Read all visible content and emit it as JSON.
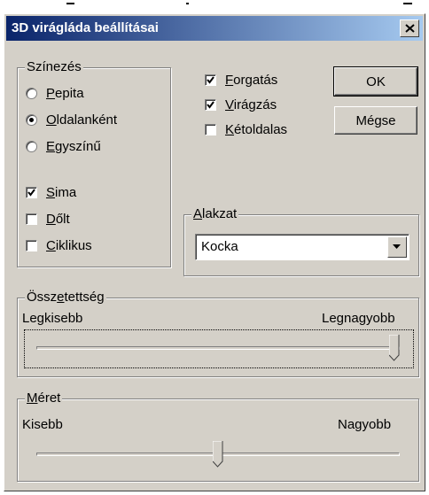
{
  "window": {
    "title": "3D virágláda beállításai",
    "close_glyph": "close-icon"
  },
  "coloring": {
    "legend": "Színezés",
    "options": [
      {
        "label": "Pepita",
        "accel": "P",
        "rest": "epita",
        "selected": false
      },
      {
        "label": "Oldalanként",
        "accel": "O",
        "rest": "ldalanként",
        "selected": true
      },
      {
        "label": "Egyszínű",
        "accel": "E",
        "rest": "gyszínű",
        "selected": false
      }
    ],
    "checks": [
      {
        "label": "Sima",
        "accel": "S",
        "rest": "ima",
        "checked": true
      },
      {
        "label": "Dőlt",
        "accel": "D",
        "rest": "őlt",
        "checked": false
      },
      {
        "label": "Ciklikus",
        "accel": "C",
        "rest": "iklikus",
        "checked": false
      }
    ]
  },
  "options": [
    {
      "label": "Forgatás",
      "accel": "F",
      "rest": "orgatás",
      "checked": true
    },
    {
      "label": "Virágzás",
      "accel": "V",
      "rest": "irágzás",
      "checked": true
    },
    {
      "label": "Kétoldalas",
      "accel": "K",
      "rest": "étoldalas",
      "checked": false
    }
  ],
  "buttons": {
    "ok": "OK",
    "cancel": "Mégse"
  },
  "shape": {
    "legend_accel": "A",
    "legend_rest": "lakzat",
    "legend": "Alakzat",
    "value": "Kocka"
  },
  "complexity": {
    "legend_pre": "Össz",
    "legend_accel": "e",
    "legend_rest": "tettség",
    "legend": "Összetettség",
    "min_label": "Legkisebb",
    "max_label": "Legnagyobb",
    "level": 1.0
  },
  "size": {
    "legend_accel": "M",
    "legend_rest": "éret",
    "legend": "Méret",
    "min_label": "Kisebb",
    "max_label": "Nagyobb",
    "level": 0.5
  },
  "colors": {
    "title_start": "#0a246a",
    "title_end": "#a6caf0",
    "face": "#d4d0c8"
  }
}
